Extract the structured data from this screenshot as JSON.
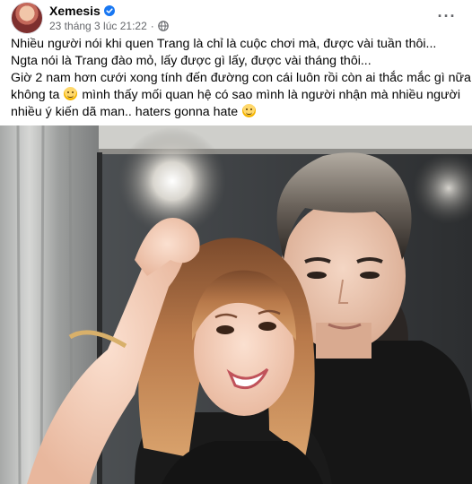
{
  "post": {
    "author": "Xemesis",
    "timestamp": "23 tháng 3 lúc 21:22",
    "separator": "·",
    "text_lines": [
      "Nhiều người nói khi quen Trang là chỉ là cuộc chơi mà, được vài tuần thôi...",
      "Ngta nói là Trang đào mỏ, lấy được gì lấy, được vài tháng thôi...",
      "Giờ 2 nam hơn cưới xong tính đến đường con cái luôn rồi còn ai thắc mắc gì nữa"
    ],
    "line4_before_emoji": "không ta ",
    "line4_after_emoji": " mình thấy mối quan hệ có sao mình là người nhận mà nhiều người",
    "line5_before_emoji": "nhiều ý kiến dã man.. haters gonna hate ",
    "icons": {
      "verified": "verified-badge-icon",
      "audience": "globe-icon",
      "more": "more-options-icon"
    },
    "colors": {
      "verified": "#1877f2",
      "meta_text": "#65676b",
      "text": "#050505"
    }
  }
}
